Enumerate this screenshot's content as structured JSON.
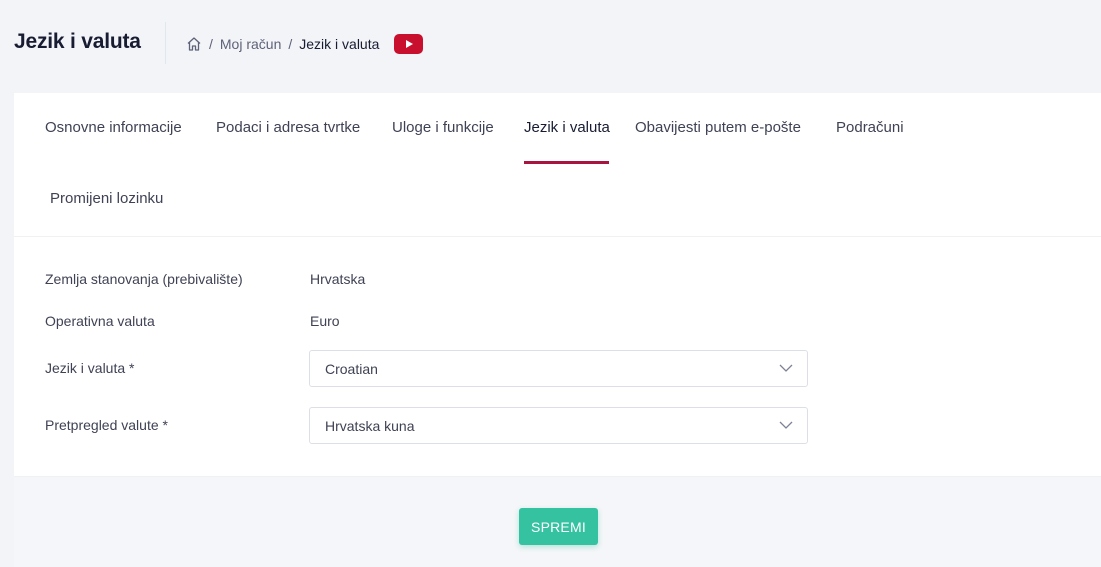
{
  "header": {
    "title": "Jezik i valuta",
    "breadcrumb": {
      "home_icon": "home-icon",
      "separator": "/",
      "items": [
        "Moj račun",
        "Jezik i valuta"
      ]
    },
    "video_icon": "youtube-icon",
    "video_color": "#c8102e"
  },
  "tabs": [
    {
      "label": "Osnovne informacije",
      "active": false
    },
    {
      "label": "Podaci i adresa tvrtke",
      "active": false
    },
    {
      "label": "Uloge i funkcije",
      "active": false
    },
    {
      "label": "Jezik i valuta",
      "active": true
    },
    {
      "label": "Obavijesti putem e-pošte",
      "active": false
    },
    {
      "label": "Podračuni",
      "active": false
    },
    {
      "label": "Promijeni lozinku",
      "active": false
    }
  ],
  "accent_color": "#a8153f",
  "form": {
    "residence": {
      "label": "Zemlja stanovanja (prebivalište)",
      "value": "Hrvatska"
    },
    "currency": {
      "label": "Operativna valuta",
      "value": "Euro"
    },
    "language": {
      "label": "Jezik i valuta *",
      "selected": "Croatian"
    },
    "preview_currency": {
      "label": "Pretpregled valute *",
      "selected": "Hrvatska kuna"
    }
  },
  "footer": {
    "save_label": "SPREMI",
    "save_color": "#34c2a1"
  }
}
